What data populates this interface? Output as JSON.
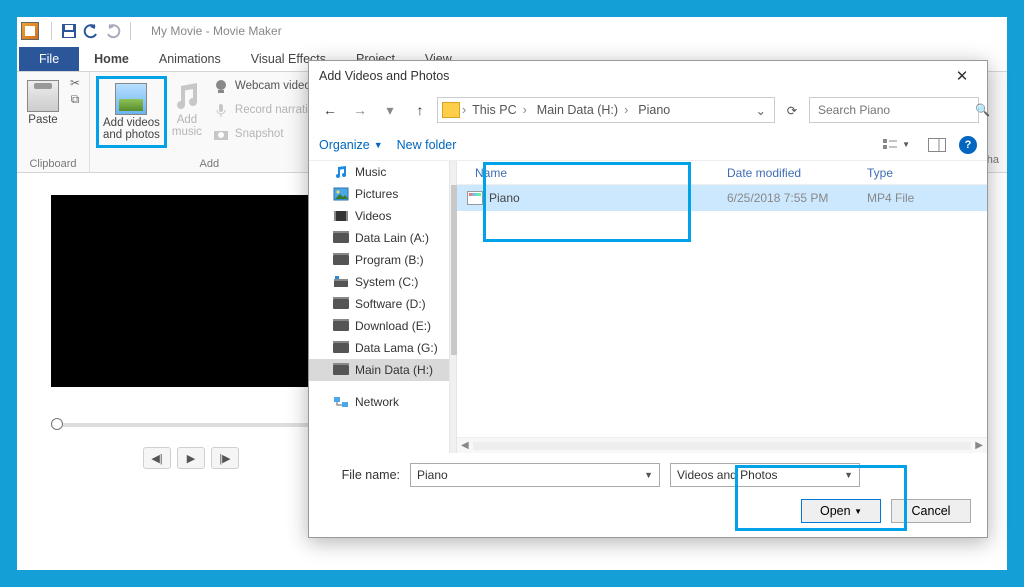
{
  "titlebar": {
    "title": "My Movie - Movie Maker"
  },
  "ribbon": {
    "tabs": {
      "file": "File",
      "home": "Home",
      "animations": "Animations",
      "visual_effects": "Visual Effects",
      "project": "Project",
      "view": "View"
    },
    "clipboard": {
      "label": "Clipboard",
      "paste": "Paste"
    },
    "add": {
      "label": "Add",
      "add_videos": "Add videos\nand photos",
      "add_music": "Add\nmusic",
      "webcam": "Webcam video",
      "record": "Record narration",
      "snapshot": "Snapshot"
    },
    "misc_right": "ha"
  },
  "dialog": {
    "title": "Add Videos and Photos",
    "path": {
      "seg1": "This PC",
      "seg2": "Main Data (H:)",
      "seg3": "Piano"
    },
    "search_placeholder": "Search Piano",
    "toolbar": {
      "organize": "Organize",
      "new_folder": "New folder"
    },
    "tree": {
      "items": [
        {
          "label": "Music",
          "icon": "music"
        },
        {
          "label": "Pictures",
          "icon": "pictures"
        },
        {
          "label": "Videos",
          "icon": "videos"
        },
        {
          "label": "Data Lain (A:)",
          "icon": "disk"
        },
        {
          "label": "Program (B:)",
          "icon": "disk"
        },
        {
          "label": "System (C:)",
          "icon": "sysdisk"
        },
        {
          "label": "Software (D:)",
          "icon": "disk"
        },
        {
          "label": "Download (E:)",
          "icon": "disk"
        },
        {
          "label": "Data Lama (G:)",
          "icon": "disk"
        },
        {
          "label": "Main Data (H:)",
          "icon": "disk"
        },
        {
          "label": "Network",
          "icon": "network"
        }
      ]
    },
    "list": {
      "columns": {
        "name": "Name",
        "date": "Date modified",
        "type": "Type"
      },
      "rows": [
        {
          "name": "Piano",
          "date": "6/25/2018 7:55 PM",
          "type": "MP4 File"
        }
      ]
    },
    "bottom": {
      "filename_label": "File name:",
      "filename_value": "Piano",
      "filter": "Videos and Photos",
      "open": "Open",
      "cancel": "Cancel"
    }
  }
}
